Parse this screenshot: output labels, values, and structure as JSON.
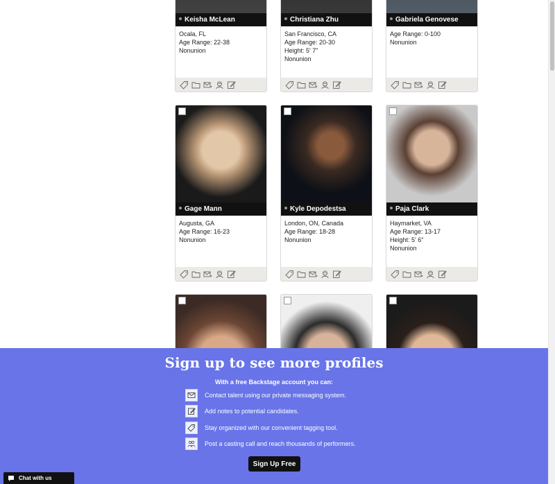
{
  "cards": [
    {
      "name": "Keisha McLean",
      "lines": [
        "Ocala, FL",
        "Age Range: 22-38",
        "Nonunion"
      ]
    },
    {
      "name": "Christiana Zhu",
      "lines": [
        "San Francisco, CA",
        "Age Range: 20-30",
        "Height: 5' 7\"",
        "Nonunion"
      ]
    },
    {
      "name": "Gabriela Genovese",
      "lines": [
        "Age Range: 0-100",
        "Nonunion"
      ]
    },
    {
      "name": "Gage Mann",
      "lines": [
        "Augusta, GA",
        "Age Range: 16-23",
        "Nonunion"
      ]
    },
    {
      "name": "Kyle Depodestsa",
      "lines": [
        "London, ON, Canada",
        "Age Range: 18-28",
        "Nonunion"
      ]
    },
    {
      "name": "Paja Clark",
      "lines": [
        "Haymarket, VA",
        "Age Range: 13-17",
        "Height: 5' 6\"",
        "Nonunion"
      ]
    },
    {
      "name": "",
      "lines": []
    },
    {
      "name": "",
      "lines": []
    },
    {
      "name": "",
      "lines": []
    }
  ],
  "card_icons": [
    "tag-icon",
    "folder-icon",
    "message-icon",
    "audition-icon",
    "note-icon"
  ],
  "signup": {
    "title": "Sign up to see more profiles",
    "subtitle": "With a free Backstage account you can:",
    "features": [
      {
        "icon": "envelope-icon",
        "text": "Contact talent using our private messaging system."
      },
      {
        "icon": "note-icon",
        "text": "Add notes to potential candidates."
      },
      {
        "icon": "tag-icon",
        "text": "Stay organized with our convenient tagging tool."
      },
      {
        "icon": "people-icon",
        "text": "Post a casting call and reach thousands of performers."
      }
    ],
    "button": "Sign Up Free"
  },
  "chat": {
    "label": "Chat with us"
  }
}
